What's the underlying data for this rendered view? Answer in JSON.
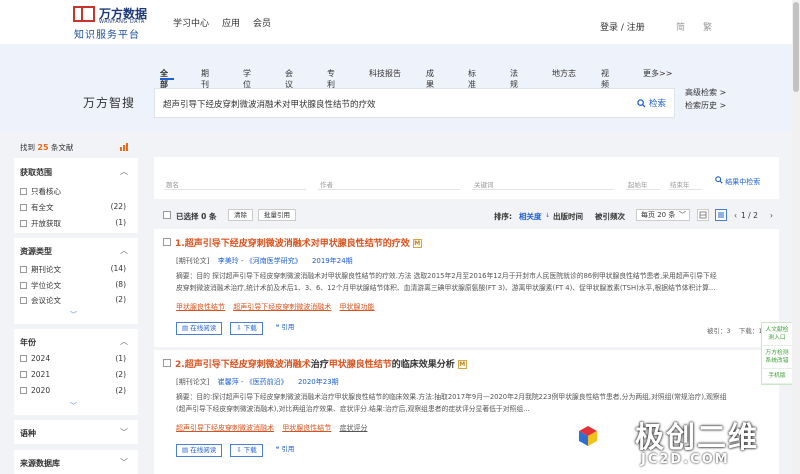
{
  "header": {
    "logo_cn": "万方数据",
    "logo_en": "WANFANG DATA",
    "logo_sub": "知识服务平台",
    "nav": [
      "学习中心",
      "应用",
      "会员"
    ],
    "login": "登录 / 注册",
    "lang": [
      "简",
      "繁"
    ]
  },
  "search": {
    "categories": [
      "全部",
      "期刊",
      "学位",
      "会议",
      "专利",
      "科技报告",
      "成果",
      "标准",
      "法规",
      "地方志",
      "视频",
      "更多>>"
    ],
    "brand": "万方智搜",
    "query": "超声引导下经皮穿刺微波消融术对甲状腺良性结节的疗效",
    "button": "检索",
    "advanced": "高级检索 >",
    "history": "检索历史 >"
  },
  "sidebar": {
    "found_prefix": "找到",
    "found_count": "25",
    "found_suffix": "条文献",
    "groups": [
      {
        "title": "获取范围",
        "items": [
          {
            "label": "只看核心",
            "count": ""
          },
          {
            "label": "有全文",
            "count": "(22)"
          },
          {
            "label": "开放获取",
            "count": "(1)"
          }
        ]
      },
      {
        "title": "资源类型",
        "items": [
          {
            "label": "期刊论文",
            "count": "(14)"
          },
          {
            "label": "学位论文",
            "count": "(8)"
          },
          {
            "label": "会议论文",
            "count": "(2)"
          }
        ]
      },
      {
        "title": "年份",
        "items": [
          {
            "label": "2024",
            "count": "(1)"
          },
          {
            "label": "2021",
            "count": "(2)"
          },
          {
            "label": "2020",
            "count": "(2)"
          }
        ]
      },
      {
        "title": "语种",
        "items": []
      },
      {
        "title": "来源数据库",
        "items": []
      }
    ]
  },
  "filters": {
    "fields": [
      "题名",
      "作者",
      "关键词",
      "起始年",
      "结束年"
    ],
    "button": "结果中检索"
  },
  "toolbar": {
    "selected": "已选择 0 条",
    "clear": "清除",
    "batch": "批量引用",
    "sort_label": "排序:",
    "sort_relevance": "相关度",
    "sort_time": "出版时间",
    "sort_cite": "被引频次",
    "per_page": "每页 20 条",
    "page": "1 / 2"
  },
  "results": [
    {
      "num": "1.",
      "title_hl": "超声引导下经皮穿刺微波消融术对甲状腺良性结节的疗效",
      "title_tail": "",
      "type": "[期刊论文]",
      "author": "李美玲",
      "journal": "《河南医学研究》",
      "year": "2019年24期",
      "abs1": "摘要：目的 探讨超声引导下经皮穿刺微波消融术对甲状腺良性结节的疗效.方法 选取2015年2月至2016年12月于开封市人民医院就诊的86例甲状腺良性结节患者,采用超声引导下经",
      "abs2": "皮穿刺微波消融术治疗,统计术前及术后1、3、6、12个月甲状腺结节体积、血清游离三碘甲状腺原氨酸(FT 3)、游离甲状腺素(FT 4)、促甲状腺激素(TSH)水平,根据结节体积计算...",
      "keywords": [
        "甲状腺良性结节",
        "超声引导下经皮穿刺微波消融术",
        "甲状腺功能"
      ],
      "actions": [
        "在线阅读",
        "下载",
        "引用"
      ],
      "stats": "被引：3    下载：18"
    },
    {
      "num": "2.",
      "title_hl": "超声引导下经皮穿刺微波消融术",
      "title_mid": "治疗",
      "title_hl2": "甲状腺良性结节",
      "title_tail": "的临床效果分析",
      "type": "[期刊论文]",
      "author": "崔馨萍",
      "journal": "《医药前沿》",
      "year": "2020年23期",
      "abs1": "摘要：目的:探讨超声引导下经皮穿刺微波消融术治疗甲状腺良性结节的临床效果.方法:抽取2017年9月—2020年2月我院223例甲状腺良性结节患者,分为两组,对照组(常规治疗),观察组",
      "abs2": "(超声引导下经皮穿刺微波消融术),对比两组治疗效果、症状评分.结果:治疗后,观察组患者的症状评分显著低于对照组...",
      "keywords": [
        "超声引导下经皮穿刺微波消融术",
        "甲状腺良性结节",
        "症状评分"
      ],
      "actions": [
        "在线阅读",
        "下载",
        "引用"
      ]
    }
  ],
  "float_panel": [
    "人文献检测入口",
    "万方检测系统改错",
    "手机版"
  ],
  "watermark": {
    "cn": "极创二维",
    "en": "JC2D.COM"
  },
  "colors": {
    "accent": "#1d5fd1",
    "highlight": "#d9531e",
    "brand_red": "#c8332c"
  }
}
